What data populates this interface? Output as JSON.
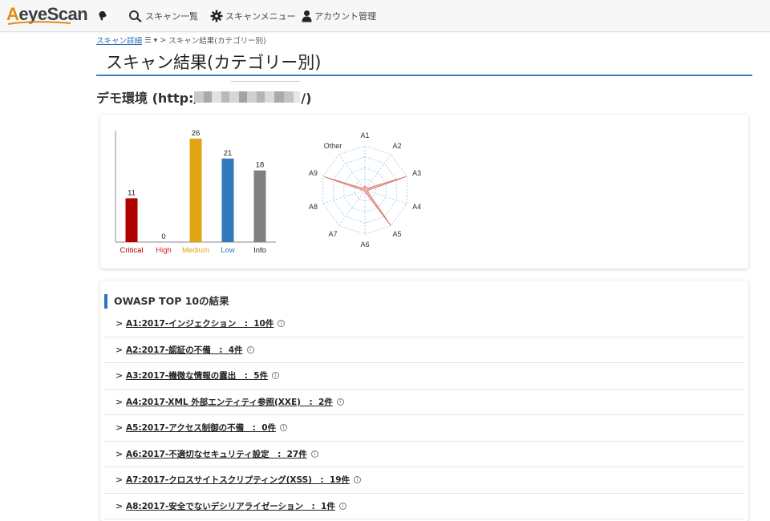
{
  "logo": {
    "first": "A",
    "rest": "eyeScan"
  },
  "nav": {
    "items": [
      {
        "label": "スキャン一覧",
        "icon": "search-icon"
      },
      {
        "label": "スキャンメニュー",
        "icon": "gear-icon"
      },
      {
        "label": "アカウント管理",
        "icon": "user-icon"
      }
    ]
  },
  "breadcrumb": {
    "link": "スキャン詳細",
    "menu_icon": "☰ ▾",
    "sep": ">",
    "current": "スキャン結果(カテゴリー別)"
  },
  "page_title": "スキャン結果(カテゴリー別)",
  "environment": {
    "prefix": "デモ環境 (http:/",
    "suffix": "/)"
  },
  "colors": {
    "accent": "#3d7cc9",
    "critical": "#b00000",
    "high": "#d3262a",
    "medium": "#e1a514",
    "low": "#3279bd",
    "info": "#808080",
    "radar_fill": "#f7b4ac",
    "radar_stroke": "#d7685c"
  },
  "chart_data": [
    {
      "type": "bar",
      "categories": [
        "Critical",
        "High",
        "Medium",
        "Low",
        "Info"
      ],
      "values": [
        11,
        0,
        26,
        21,
        18
      ],
      "ylim": [
        0,
        28
      ],
      "colors": [
        "#b00000",
        "#d3262a",
        "#e1a514",
        "#3279bd",
        "#808080"
      ],
      "label_colors": [
        "#b00000",
        "#d3262a",
        "#e1a514",
        "#3279bd",
        "#222222"
      ]
    },
    {
      "type": "radar",
      "categories": [
        "A1",
        "A2",
        "A3",
        "A4",
        "A5",
        "A6",
        "A7",
        "A8",
        "A9",
        "Other"
      ],
      "values": [
        0.1,
        0.04,
        0.98,
        0.05,
        1.0,
        0.04,
        0.03,
        0.04,
        0.97,
        0.04
      ],
      "rmax": 1
    }
  ],
  "owasp": {
    "title": "OWASP TOP 10の結果",
    "items": [
      {
        "label": "A1:2017-インジェクション　:  10件"
      },
      {
        "label": "A2:2017-認証の不備　:  4件"
      },
      {
        "label": "A3:2017-機微な情報の露出　:  5件"
      },
      {
        "label": "A4:2017-XML 外部エンティティ参照(XXE)　:  2件"
      },
      {
        "label": "A5:2017-アクセス制御の不備　:  0件"
      },
      {
        "label": "A6:2017-不適切なセキュリティ設定　:  27件"
      },
      {
        "label": "A7:2017-クロスサイトスクリプティング(XSS)　:  19件"
      },
      {
        "label": "A8:2017-安全でないデシリアライゼーション　:  1件"
      }
    ],
    "info_glyph": "i"
  }
}
